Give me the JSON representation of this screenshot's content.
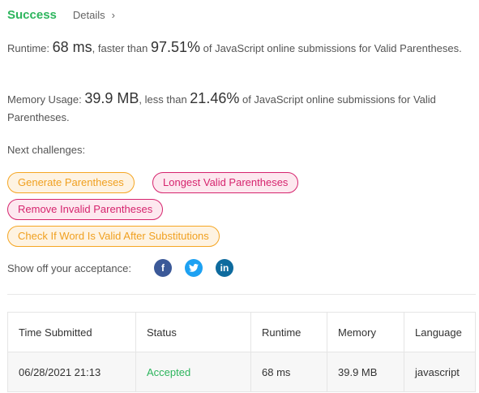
{
  "header": {
    "status": "Success",
    "details_label": "Details",
    "details_chevron": "›"
  },
  "runtime": {
    "label": "Runtime: ",
    "value": "68 ms",
    "mid": ", faster than ",
    "percent": "97.51%",
    "suffix": " of JavaScript online submissions for Valid Parentheses."
  },
  "memory": {
    "label": "Memory Usage: ",
    "value": "39.9 MB",
    "mid": ", less than ",
    "percent": "21.46%",
    "suffix": " of JavaScript online submissions for Valid Parentheses."
  },
  "next": {
    "label": "Next challenges:",
    "challenges": [
      {
        "title": "Generate Parentheses",
        "difficulty": "medium"
      },
      {
        "title": "Longest Valid Parentheses",
        "difficulty": "hard"
      },
      {
        "title": "Remove Invalid Parentheses",
        "difficulty": "hard"
      },
      {
        "title": "Check If Word Is Valid After Substitutions",
        "difficulty": "medium"
      }
    ]
  },
  "share": {
    "label": "Show off your acceptance:",
    "icons": {
      "facebook": "f",
      "twitter": "t",
      "linkedin": "in"
    }
  },
  "colors": {
    "success": "#2db55d",
    "medium": "#f5a623",
    "hard": "#d6246e"
  },
  "table": {
    "headers": [
      "Time Submitted",
      "Status",
      "Runtime",
      "Memory",
      "Language"
    ],
    "rows": [
      [
        "06/28/2021 21:13",
        "Accepted",
        "68 ms",
        "39.9 MB",
        "javascript"
      ]
    ]
  }
}
